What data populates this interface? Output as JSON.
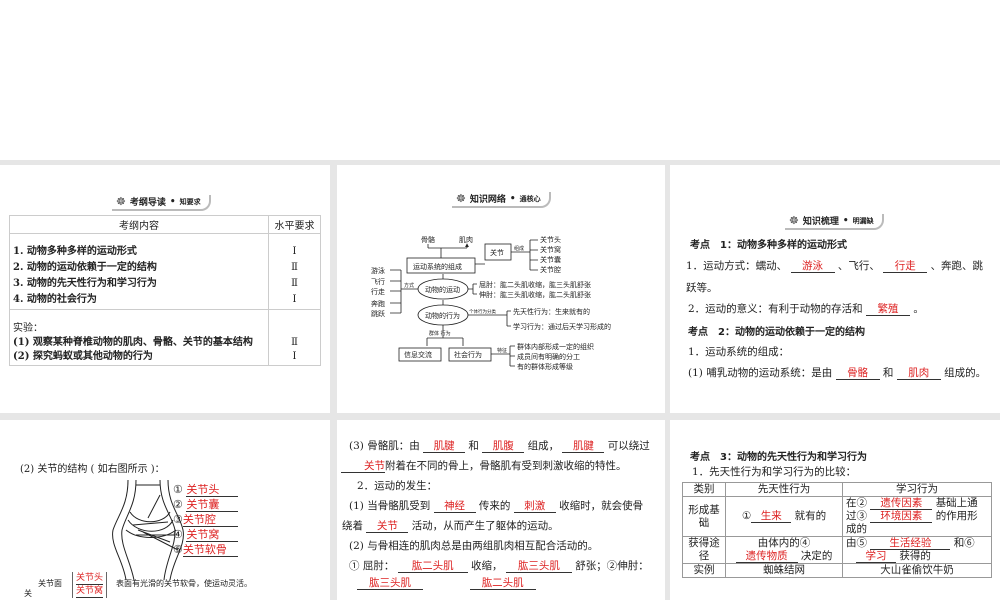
{
  "slide1": {
    "banner_title": "考纲导读",
    "banner_sub": "知要求",
    "headers": [
      "考纲内容",
      "水平要求"
    ],
    "rows": [
      {
        "text": "1. 动物多种多样的运动形式",
        "level": "Ⅰ"
      },
      {
        "text": "2. 动物的运动依赖于一定的结构",
        "level": "Ⅱ"
      },
      {
        "text": "3. 动物的先天性行为和学习行为",
        "level": "Ⅱ"
      },
      {
        "text": "4. 动物的社会行为",
        "level": "Ⅰ"
      }
    ],
    "exp_label": "实验：",
    "exp_rows": [
      {
        "text": "(1) 观察某种脊椎动物的肌肉、骨骼、关节的基本结构",
        "level": "Ⅱ"
      },
      {
        "text": "(2) 探究蚂蚁或其他动物的行为",
        "level": "Ⅰ"
      }
    ]
  },
  "slide2": {
    "banner_title": "知识网络",
    "banner_sub": "通核心",
    "nodes": {
      "bone": "骨骼",
      "muscle": "肌肉",
      "system": "运动系统的组成",
      "joint": "关节",
      "compose": "组成",
      "joint_parts": [
        "关节头",
        "关节窝",
        "关节囊",
        "关节腔"
      ],
      "ways": [
        "游泳",
        "飞行",
        "行走",
        "奔跑",
        "跳跃"
      ],
      "way_label": "方式",
      "movement": "动物的运动",
      "flex": "屈肘：肱二头肌收缩，肱三头肌舒张",
      "extend": "伸肘：肱三头肌收缩，肱二头肌舒张",
      "behavior": "动物的行为",
      "individual": "个体行为分类",
      "innate": "先天性行为：生来就有的",
      "learned": "学习行为：通过后天学习形成的",
      "group": "群体 行为",
      "info": "信息交流",
      "social": "社会行为",
      "feature": "特征",
      "social_features": [
        "群体内部形成一定的组织",
        "成员间有明确的分工",
        "有的群体形成等级"
      ]
    }
  },
  "slide3": {
    "banner_title": "知识梳理",
    "banner_sub": "明漏缺",
    "k1": "考点　1：动物多种多样的运动形式",
    "l1a": "1．运动方式：蠕动、",
    "a1": "游泳",
    "l1b": "、飞行、",
    "a2": "行走",
    "l1c": "、奔跑、跳",
    "l1d": "跃等。",
    "l2a": "2．运动的意义：有利于动物的存活和",
    "a3": "繁殖",
    "l2b": "。",
    "k2": "考点　2：动物的运动依赖于一定的结构",
    "l3": "1．运动系统的组成：",
    "l4a": "(1) 哺乳动物的运动系统：是由",
    "a4": "骨骼",
    "l4b": "和",
    "a5": "肌肉",
    "l4c": "组成的。"
  },
  "slide4": {
    "title": "(2) 关节的结构 ( 如右图所示 )：",
    "labels": [
      {
        "num": "①",
        "ans": "关节头"
      },
      {
        "num": "②",
        "ans": "关节囊"
      },
      {
        "num": "③",
        "ans": "关节腔"
      },
      {
        "num": "④",
        "ans": "关节窝"
      },
      {
        "num": "⑤",
        "ans": "关节软骨"
      }
    ],
    "bottom_pre": "关",
    "bottom_a": "关节面",
    "bottom_top": "关节头",
    "bottom_bot": "关节窝",
    "bottom_b": "表面有光滑的关节软骨，使运动灵活。"
  },
  "slide5": {
    "l1a": "(3) 骨骼肌：由",
    "a1": "肌腱",
    "l1b": "和",
    "a2": "肌腹",
    "l1c": "组成，",
    "a3": "肌腱",
    "l1d": "可以绕过",
    "a4": "关节",
    "l2": "附着在不同的骨上，骨骼肌有受到刺激收缩的特性。",
    "l3": "2．运动的发生：",
    "l4a": "(1) 当骨骼肌受到",
    "a5": "神经",
    "l4b": "传来的",
    "a6": "刺激",
    "l4c": "收缩时，就会使骨",
    "l5a": "绕着",
    "a7": "关节",
    "l5b": "活动，从而产生了躯体的运动。",
    "l6": "(2) 与骨相连的肌肉总是由两组肌肉相互配合活动的。",
    "l7a": "① 屈肘：",
    "a8": "肱二头肌",
    "l7b": "收缩，",
    "a9": "肱三头肌",
    "l7c": "舒张；②伸肘：",
    "a10": "肱三头肌",
    "a11": "肱二头肌"
  },
  "slide6": {
    "k3": "考点　3：动物的先天性行为和学习行为",
    "l1": "1．先天性行为和学习行为的比较：",
    "headers": [
      "类别",
      "先天性行为",
      "学习行为"
    ],
    "r1": {
      "cat": "形成基础",
      "innate_pre": "①",
      "innate_ans": "生来",
      "innate_post": "就有的",
      "l_a": "在②",
      "l_ans1": "遗传因素",
      "l_b": "基础上通",
      "l_c": "过③",
      "l_ans2": "环境因素",
      "l_d": "的作用形",
      "l_e": "成的"
    },
    "r2": {
      "cat": "获得途径",
      "innate_pre": "由体内的④",
      "innate_ans": "遗传物质",
      "innate_post": "决定的",
      "l_a": "由⑤",
      "l_ans1": "生活经验",
      "l_b": "和⑥",
      "l_ans2": "学习",
      "l_c": "获得的"
    },
    "r3": {
      "cat": "实例",
      "innate": "蜘蛛结网",
      "learned": "大山雀偷饮牛奶"
    }
  }
}
